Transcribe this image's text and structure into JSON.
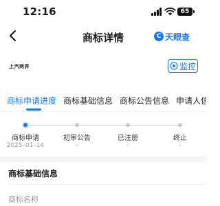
{
  "status_bar": {
    "time": "12:16",
    "battery": "65"
  },
  "nav": {
    "title": "商标详情",
    "brand_badge": "C",
    "brand_name": "天眼查"
  },
  "trademark": {
    "logo_text": "上汽两界",
    "monitor_label": "监控"
  },
  "tabs": [
    {
      "label": "商标申请进度"
    },
    {
      "label": "商标基础信息"
    },
    {
      "label": "商标公告信息"
    },
    {
      "label": "申请人信"
    }
  ],
  "progress": {
    "steps": [
      {
        "label": "商标申请",
        "date": "2025–01–14"
      },
      {
        "label": "初审公告",
        "date": "–"
      },
      {
        "label": "已注册",
        "date": "–"
      },
      {
        "label": "终止",
        "date": "–"
      }
    ],
    "active_step": 0
  },
  "basic_info": {
    "title": "商标基础信息",
    "field_name_label": "商标名称"
  },
  "colors": {
    "accent": "#1677ff"
  }
}
